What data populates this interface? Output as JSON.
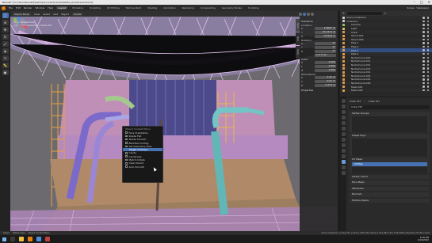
{
  "window": {
    "title": "Blender* [C:\\Users\\Daniel\\Desktop\\Course\\Scene\\stabilis-ya-textured.blend]",
    "controls": [
      "–",
      "□",
      "✕"
    ]
  },
  "menubar": {
    "menus": [
      "File",
      "Edit",
      "Render",
      "Window",
      "Help"
    ],
    "workspaces": [
      "Layout",
      "Modeling",
      "Sculpting",
      "UV Editing",
      "Texture Paint",
      "Shading",
      "Animation",
      "Rendering",
      "Compositing",
      "Geometry Nodes",
      "Scripting"
    ],
    "active_workspace": "Layout",
    "scene": "Scene",
    "view_layer": "ViewLayer"
  },
  "viewport_header": {
    "mode": "Object Mode",
    "menus": [
      "View",
      "Select",
      "Add",
      "Object"
    ],
    "transform": "Global"
  },
  "viewport_info": {
    "line1": "User Perspective",
    "line2": "(1) Scene Collection | Cube.747"
  },
  "npanel": {
    "tabs": [
      "Item",
      "Tool",
      "View"
    ],
    "transform_title": "Transform",
    "location_label": "Location:",
    "location": [
      {
        "axis": "X",
        "value": "1.6097 m"
      },
      {
        "axis": "Y",
        "value": "-19.1211 m"
      },
      {
        "axis": "Z",
        "value": "0.5103 m"
      }
    ],
    "rotation_label": "Rotation:",
    "rotation": [
      {
        "axis": "X",
        "value": "0°"
      },
      {
        "axis": "Y",
        "value": "0°"
      },
      {
        "axis": "Z",
        "value": "0°"
      }
    ],
    "rotation_mode": "XYZ Euler",
    "scale_label": "Scale:",
    "scale": [
      {
        "axis": "X",
        "value": "1.000"
      },
      {
        "axis": "Y",
        "value": "1.000"
      },
      {
        "axis": "Z",
        "value": "1.000"
      }
    ],
    "dimensions_label": "Dimensions:",
    "dimensions": [
      {
        "axis": "X",
        "value": "1.21 m"
      },
      {
        "axis": "Y",
        "value": "0.21 m"
      },
      {
        "axis": "Z",
        "value": "0.175 m"
      }
    ],
    "properties_label": "Properties"
  },
  "context_menu": {
    "title": "Object Context Menu",
    "items": [
      {
        "label": "Face Orientation",
        "checked": false
      },
      {
        "label": "Shade Flat",
        "checked": false
      },
      {
        "label": "Shade Smooth",
        "checked": false
      },
      {
        "label": "Backface Culling",
        "checked": false
      },
      {
        "label": "Set Geometry View",
        "checked": false
      },
      {
        "label": "Toggle Overlays",
        "checked": true,
        "highlighted": true
      },
      {
        "label": "Cavity",
        "checked": false
      },
      {
        "label": "Landscape",
        "checked": false
      },
      {
        "label": "Match X-Data",
        "checked": false
      },
      {
        "label": "Clear Parent",
        "checked": false
      },
      {
        "label": "Auto Smooth",
        "checked": false
      }
    ]
  },
  "outliner": {
    "rows": [
      {
        "label": "Scene Collection",
        "color": "#cfcfcf",
        "sel": false
      },
      {
        "label": "Collection",
        "color": "#cfcfcf",
        "sel": false
      },
      {
        "label": "Camera",
        "color": "#9bbf6a",
        "sel": false
      },
      {
        "label": "Light",
        "color": "#d6c36a",
        "sel": false
      },
      {
        "label": "Cube",
        "color": "#e09b4a",
        "sel": false
      },
      {
        "label": "Struct.001",
        "color": "#e09b4a",
        "sel": false
      },
      {
        "label": "Struct.002",
        "color": "#e09b4a",
        "sel": false
      },
      {
        "label": "Pipe.1",
        "color": "#e09b4a",
        "sel": false
      },
      {
        "label": "Pipe.2",
        "color": "#e09b4a",
        "sel": false
      },
      {
        "label": "Pipe.3",
        "color": "#e09b4a",
        "sel": true
      },
      {
        "label": "Pipe.4",
        "color": "#e09b4a",
        "sel": false
      },
      {
        "label": "NurbsCurve.010",
        "color": "#e09b4a",
        "sel": false
      },
      {
        "label": "NurbsCurve.011",
        "color": "#e09b4a",
        "sel": false
      },
      {
        "label": "NurbsCurve.012",
        "color": "#e09b4a",
        "sel": false
      },
      {
        "label": "NurbsCurve.013",
        "color": "#e09b4a",
        "sel": false
      },
      {
        "label": "NurbsCurve.014",
        "color": "#e09b4a",
        "sel": false
      },
      {
        "label": "NurbsCurve.015",
        "color": "#e09b4a",
        "sel": false
      },
      {
        "label": "NurbsCurve.016",
        "color": "#e09b4a",
        "sel": false
      },
      {
        "label": "NurbsCurve.018",
        "color": "#e09b4a",
        "sel": false
      },
      {
        "label": "Mesh.001",
        "color": "#e09b4a",
        "sel": false
      },
      {
        "label": "Mesh.002",
        "color": "#e09b4a",
        "sel": false
      }
    ]
  },
  "properties": {
    "breadcrumb_obj": "Cube.747",
    "breadcrumb_data": "Cube.747",
    "mesh_name": "Cube.747",
    "panels": {
      "vertex_groups": "Vertex Groups",
      "shape_keys": "Shape Keys",
      "uv_maps": "UV Maps",
      "uv_map_name": "UVMap",
      "vertex_colors": "Vertex Colors",
      "face_maps": "Face Maps",
      "attributes": "Attributes",
      "normals": "Normals",
      "texture_space": "Texture Space"
    }
  },
  "statusbar": {
    "left1": "Select",
    "left2": "Rotate View",
    "left3": "Object Context Menu",
    "stats": "Scene Collection | Cube.747 | Verts 1,504,126 | Faces 1,521,083 | Tris 3,033,648 | Objects 1/2,138 | 3.0.0"
  },
  "taskbar": {
    "time": "4:56 PM",
    "date": "1/10/2022"
  }
}
